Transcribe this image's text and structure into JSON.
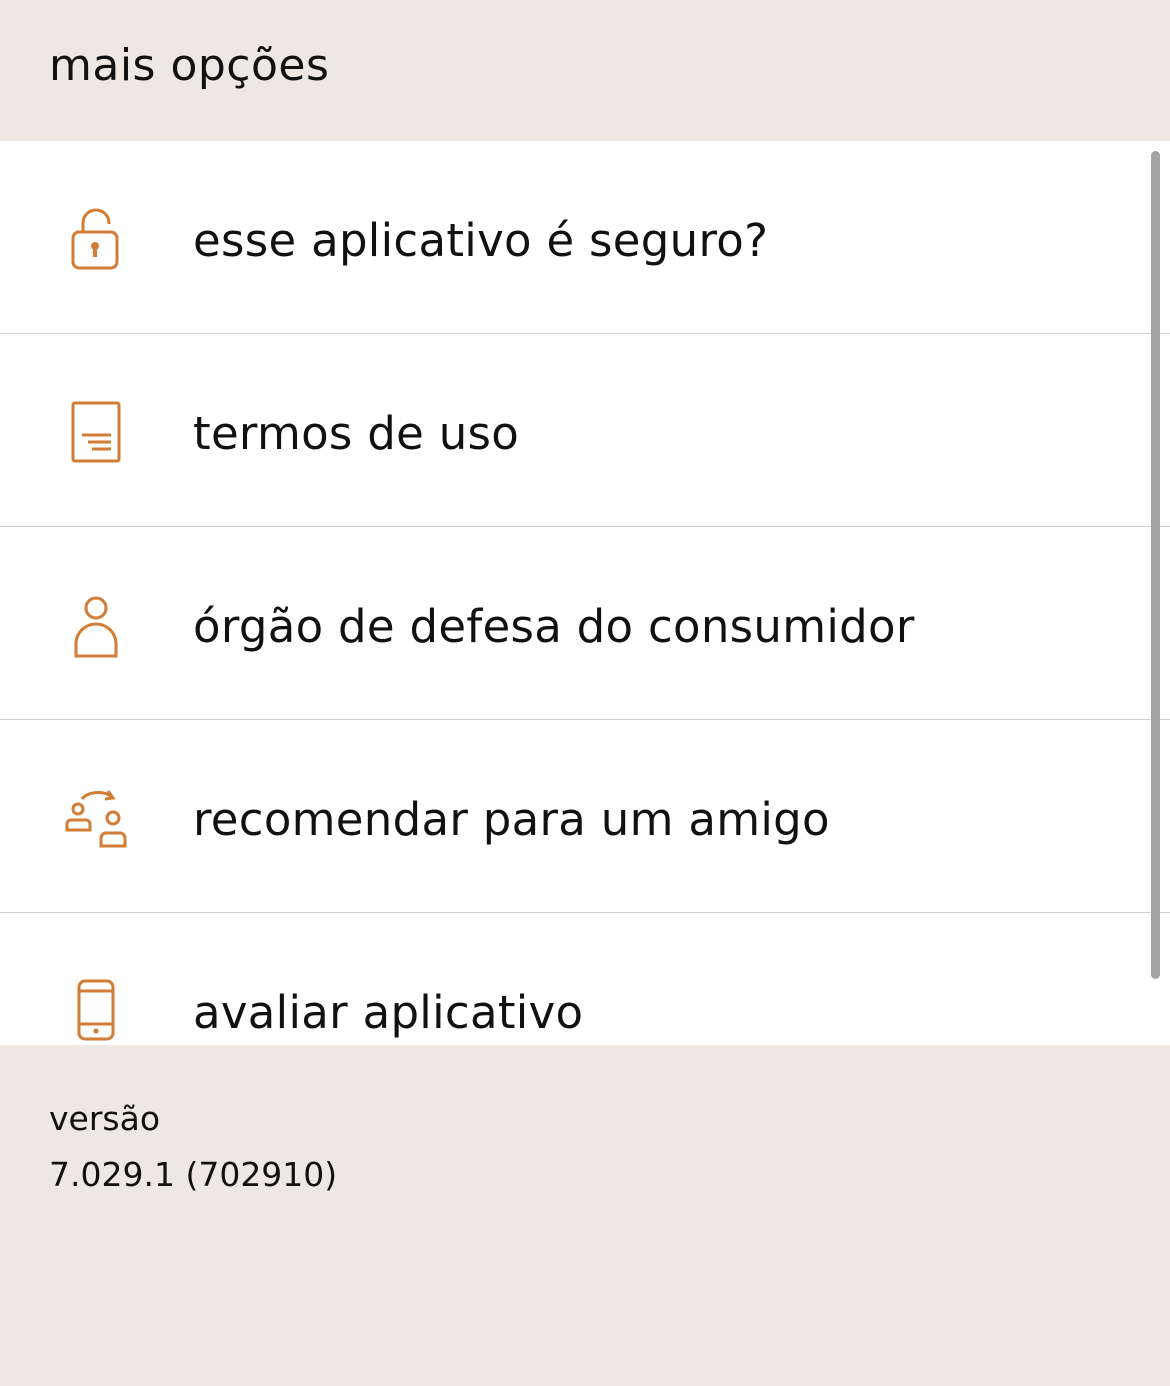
{
  "header": {
    "title": "mais opções"
  },
  "menu": {
    "items": [
      {
        "label": "esse aplicativo é seguro?",
        "icon": "lock-icon"
      },
      {
        "label": "termos de uso",
        "icon": "document-icon"
      },
      {
        "label": "órgão de defesa do consumidor",
        "icon": "person-icon"
      },
      {
        "label": "recomendar para um amigo",
        "icon": "share-friend-icon"
      },
      {
        "label": "avaliar aplicativo",
        "icon": "phone-icon"
      }
    ]
  },
  "footer": {
    "version_label": "versão",
    "version_value": "7.029.1 (702910)"
  },
  "colors": {
    "accent": "#d27c35",
    "background": "#ede8e4",
    "list_background": "#ffffff",
    "divider": "#cfcfcf",
    "text": "#111111"
  }
}
